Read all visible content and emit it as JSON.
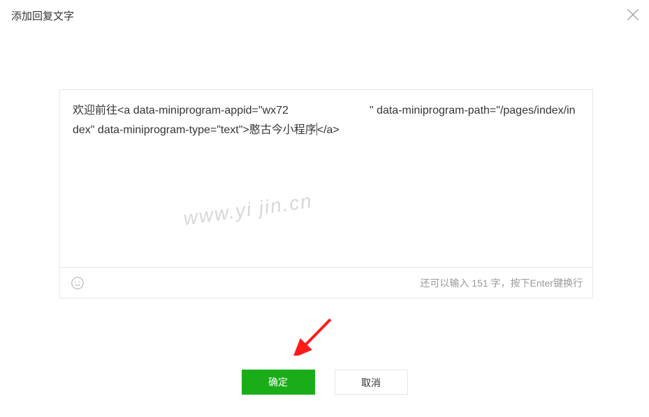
{
  "modal": {
    "title": "添加回复文字"
  },
  "editor": {
    "content_prefix": "欢迎前往<a data-miniprogram-appid=\"wx72",
    "content_suffix": "\" data-miniprogram-path=\"/pages/index/index\" data-miniprogram-type=\"text\">憨古今小程序",
    "content_tail": "</a>",
    "counter_prefix": "还可以输入 ",
    "counter_count": "151",
    "counter_suffix": " 字，按下Enter键换行"
  },
  "buttons": {
    "ok": "确定",
    "cancel": "取消"
  },
  "watermark": "www.yi  jin.cn"
}
